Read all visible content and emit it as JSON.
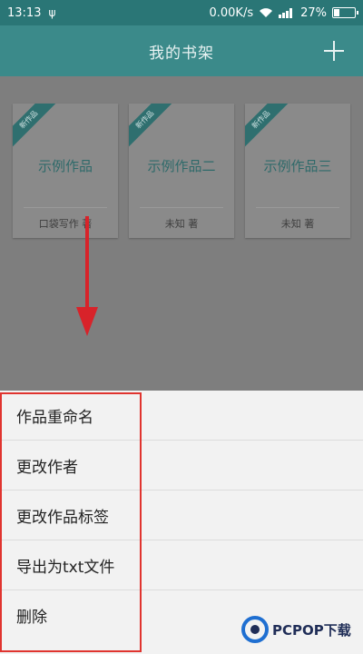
{
  "status_bar": {
    "time": "13:13",
    "usb_icon": "usb-icon",
    "speed": "0.00K/s",
    "battery": "27%",
    "battery_level": 0.27
  },
  "app_bar": {
    "title": "我的书架",
    "add_icon": "plus-icon"
  },
  "books": [
    {
      "badge": "新作品",
      "title": "示例作品",
      "author": "口袋写作 著"
    },
    {
      "badge": "新作品",
      "title": "示例作品二",
      "author": "未知 著"
    },
    {
      "badge": "新作品",
      "title": "示例作品三",
      "author": "未知 著"
    }
  ],
  "menu": {
    "items": [
      {
        "label": "作品重命名"
      },
      {
        "label": "更改作者"
      },
      {
        "label": "更改作品标签"
      },
      {
        "label": "导出为txt文件"
      },
      {
        "label": "删除"
      }
    ]
  },
  "watermark": {
    "text": "PCPOP下载"
  },
  "colors": {
    "primary": "#3b8a8a",
    "status_bar": "#2a7676",
    "annotation": "#e0342f"
  }
}
